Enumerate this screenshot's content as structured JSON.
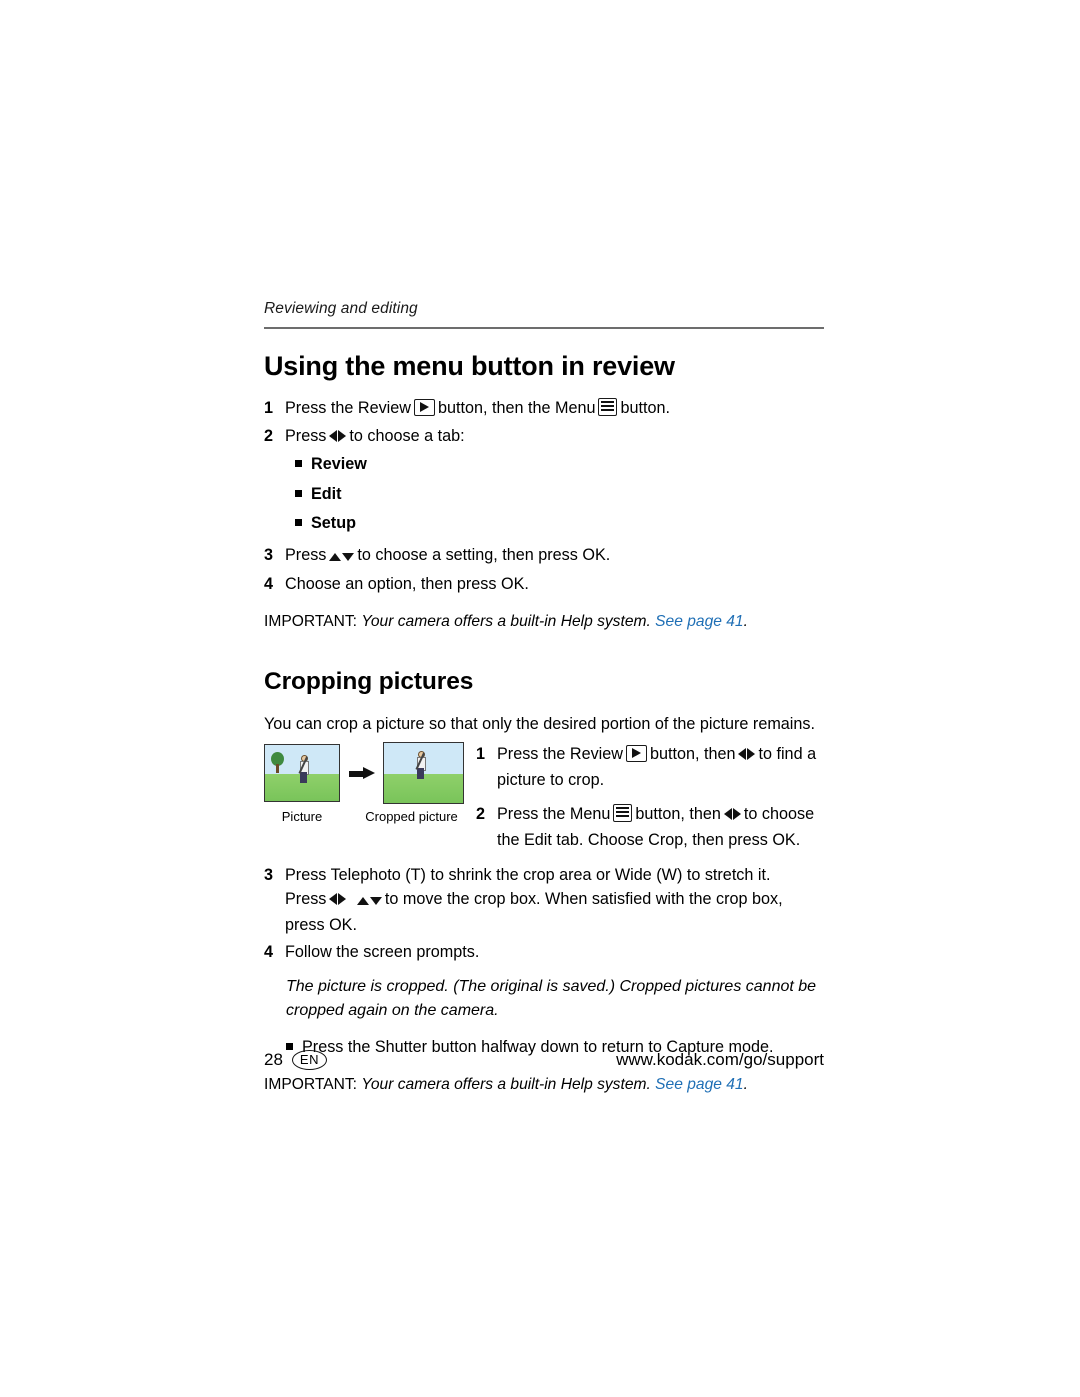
{
  "header": {
    "running_head": "Reviewing and editing"
  },
  "section1": {
    "title": "Using the menu button in review",
    "steps": [
      {
        "num": "1",
        "text_before": "Press the Review",
        "icon1": "play-button-icon",
        "text_mid": "button, then the Menu",
        "icon2": "menu-button-icon",
        "text_after": "button."
      },
      {
        "num": "2",
        "text_before": "Press",
        "icon1": "left-right-arrows-icon",
        "text_after": "to choose a tab:"
      },
      {
        "num": "3",
        "text_before": "Press",
        "icon1": "up-down-arrows-icon",
        "text_after": "to choose a setting, then press OK."
      },
      {
        "num": "4",
        "text_before": "Choose an option, then press OK."
      }
    ],
    "tabs": [
      "Review",
      "Edit",
      "Setup"
    ],
    "important": {
      "label": "IMPORTANT:",
      "text": "Your camera offers a built-in Help system.",
      "link": "See page 41",
      "period": "."
    }
  },
  "section2": {
    "title": "Cropping pictures",
    "intro": "You can crop a picture so that only the desired portion of the picture remains.",
    "figure": {
      "caption_left": "Picture",
      "caption_right": "Cropped picture"
    },
    "steps": [
      {
        "num": "1",
        "text_before": "Press the Review",
        "icon1": "play-button-icon",
        "text_mid": "button, then",
        "icon2": "left-right-arrows-icon",
        "text_after": "to find a picture to crop."
      },
      {
        "num": "2",
        "text_before": "Press the Menu",
        "icon1": "menu-button-icon",
        "text_mid": "button, then",
        "icon2": "left-right-arrows-icon",
        "text_after": "to choose the Edit tab. Choose Crop, then press OK."
      },
      {
        "num": "3",
        "text_line1": "Press Telephoto (T) to shrink the crop area or Wide (W) to stretch it.",
        "text_before": "Press",
        "icon1": "left-right-arrows-icon",
        "icon2": "up-down-arrows-icon",
        "text_after": "to move the crop box. When satisfied with the crop box, press OK."
      },
      {
        "num": "4",
        "text_before": "Follow the screen prompts."
      }
    ],
    "note": "The picture is cropped. (The original is saved.) Cropped pictures cannot be cropped again on the camera.",
    "bullet": "Press the Shutter button halfway down to return to Capture mode.",
    "important": {
      "label": "IMPORTANT:",
      "text": "Your camera offers a built-in Help system.",
      "link": "See page 41",
      "period": "."
    }
  },
  "footer": {
    "page_number": "28",
    "language": "EN",
    "url": "www.kodak.com/go/support"
  },
  "colors": {
    "link": "#1f6fb5",
    "rule": "#6d6d6d"
  }
}
